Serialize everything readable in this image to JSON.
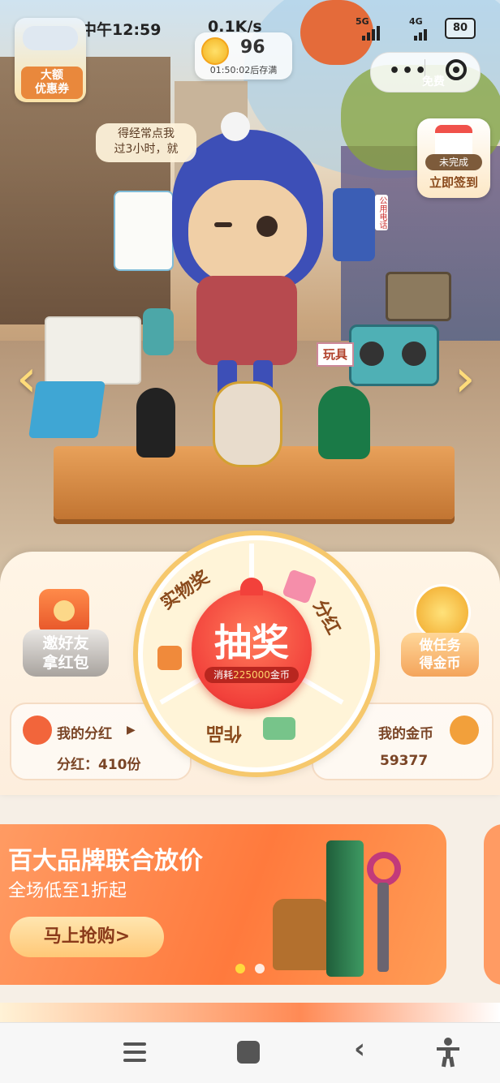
{
  "status_bar": {
    "time": "中午12:59",
    "network_speed": "0.1K/s",
    "sim1": "5G",
    "sim2": "4G",
    "battery": "80"
  },
  "coin_pill": {
    "count": "96",
    "timer": "01:50:02后存满"
  },
  "coupon_badge": {
    "label": "大额\n优惠券"
  },
  "top_right": {
    "promo_text": "免费"
  },
  "speech_bubble": {
    "text": "得经常点我\n过3小时，就"
  },
  "checkin": {
    "status": "未完成",
    "action": "立即签到"
  },
  "sign": {
    "toys": "玩具",
    "phone": "公用电话"
  },
  "wheel": {
    "center_title": "抽奖",
    "cost_prefix": "消耗",
    "cost_value": "225000",
    "cost_suffix": "金币",
    "seg_top_left": "实物奖",
    "seg_right": "分红",
    "seg_bottom": "作品"
  },
  "left_task": {
    "label": "邀好友\n拿红包"
  },
  "right_task": {
    "label": "做任务\n得金币"
  },
  "my_dividend": {
    "title": "我的分红",
    "value": "分红：410份"
  },
  "my_coins": {
    "title": "我的金币",
    "value": "59377"
  },
  "banner": {
    "title": "百大品牌联合放价",
    "subtitle": "全场低至1折起",
    "button": "马上抢购>"
  },
  "colors": {
    "accent_orange": "#ff7a3d",
    "wheel_red": "#f2413b",
    "gold": "#f6c86d"
  }
}
